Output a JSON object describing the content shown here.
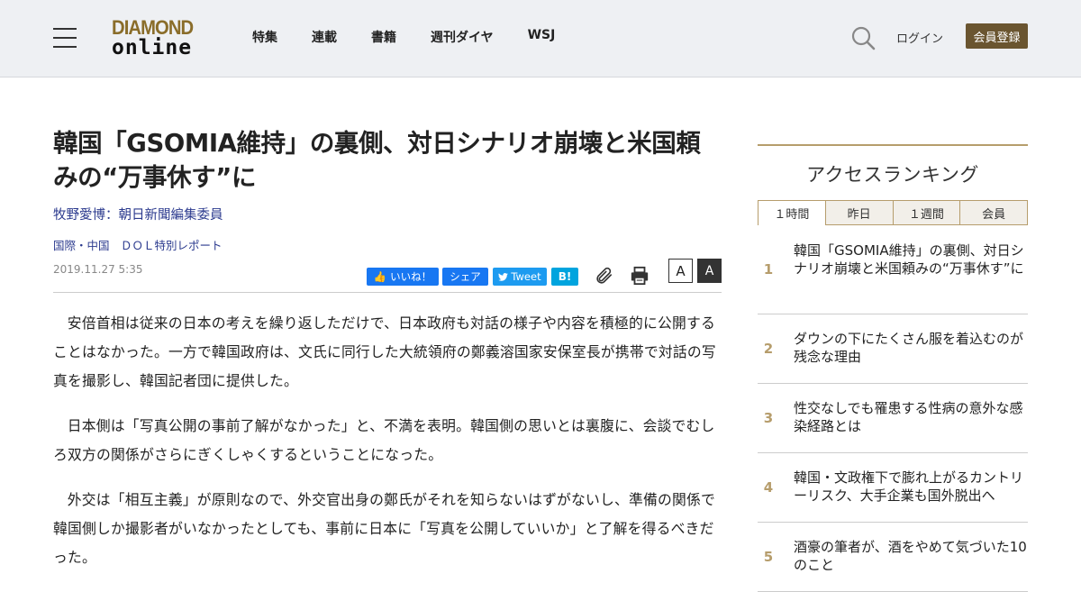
{
  "header": {
    "logo_top": "DIAMOND",
    "logo_bottom": "online",
    "nav": [
      "特集",
      "連載",
      "書籍",
      "週刊ダイヤ",
      "WSJ"
    ],
    "login": "ログイン",
    "register": "会員登録"
  },
  "article": {
    "title": "韓国「GSOMIA維持」の裏側、対日シナリオ崩壊と米国頼みの“万事休す”に",
    "author": "牧野愛博：朝日新聞編集委員",
    "category": "国際・中国　ＤＯＬ特別レポート",
    "date": "2019.11.27 5:35",
    "share": {
      "like": "いいね！",
      "share": "シェア",
      "tweet": "Tweet",
      "hatena": "B!",
      "font_small": "A",
      "font_large": "A"
    },
    "paragraphs": [
      "安倍首相は従来の日本の考えを繰り返しただけで、日本政府も対話の様子や内容を積極的に公開することはなかった。一方で韓国政府は、文氏に同行した大統領府の鄭義溶国家安保室長が携帯で対話の写真を撮影し、韓国記者団に提供した。",
      "日本側は「写真公開の事前了解がなかった」と、不満を表明。韓国側の思いとは裏腹に、会談でむしろ双方の関係がさらにぎくしゃくするということになった。",
      "外交は「相互主義」が原則なので、外交官出身の鄭氏がそれを知らないはずがないし、準備の関係で韓国側しか撮影者がいなかったとしても、事前に日本に「写真を公開していいか」と了解を得るべきだった。"
    ]
  },
  "sidebar": {
    "title": "アクセスランキング",
    "tabs": [
      "１時間",
      "昨日",
      "１週間",
      "会員"
    ],
    "ranking": [
      {
        "rank": "1",
        "text": "韓国「GSOMIA維持」の裏側、対日シナリオ崩壊と米国頼みの“万事休す”に"
      },
      {
        "rank": "2",
        "text": "ダウンの下にたくさん服を着込むのが残念な理由"
      },
      {
        "rank": "3",
        "text": "性交なしでも罹患する性病の意外な感染経路とは"
      },
      {
        "rank": "4",
        "text": "韓国・文政権下で膨れ上がるカントリーリスク、大手企業も国外脱出へ"
      },
      {
        "rank": "5",
        "text": "酒豪の筆者が、酒をやめて気づいた10のこと"
      }
    ]
  }
}
